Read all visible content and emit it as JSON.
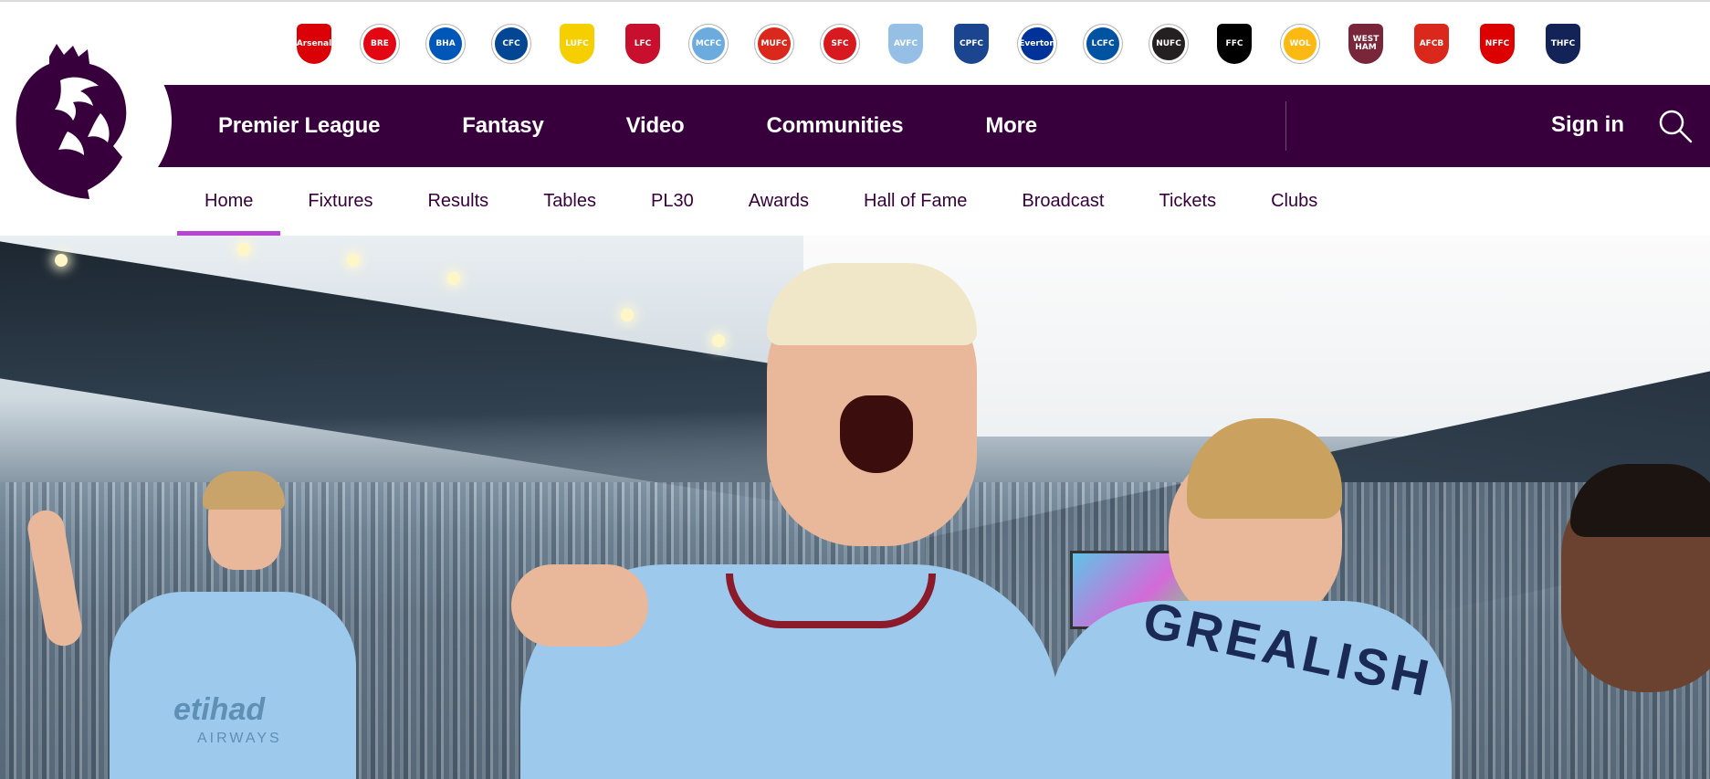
{
  "clubs": [
    {
      "name": "Arsenal",
      "abbr": "Arsenal",
      "color": "#db0007",
      "shape": "shield"
    },
    {
      "name": "Brentford",
      "abbr": "BRE",
      "color": "#e30613",
      "shape": "round"
    },
    {
      "name": "Brighton",
      "abbr": "BHA",
      "color": "#0057b8",
      "shape": "round"
    },
    {
      "name": "Chelsea",
      "abbr": "CFC",
      "color": "#034694",
      "shape": "round"
    },
    {
      "name": "Leeds United",
      "abbr": "LUFC",
      "color": "#f5cf00",
      "shape": "shield"
    },
    {
      "name": "Liverpool",
      "abbr": "LFC",
      "color": "#c8102e",
      "shape": "shield"
    },
    {
      "name": "Manchester City",
      "abbr": "MCFC",
      "color": "#6cabdd",
      "shape": "round"
    },
    {
      "name": "Manchester United",
      "abbr": "MUFC",
      "color": "#da291c",
      "shape": "round"
    },
    {
      "name": "Southampton",
      "abbr": "SFC",
      "color": "#d71920",
      "shape": "round"
    },
    {
      "name": "Aston Villa",
      "abbr": "AVFC",
      "color": "#95bfe5",
      "shape": "shield"
    },
    {
      "name": "Crystal Palace",
      "abbr": "CPFC",
      "color": "#1b458f",
      "shape": "shield"
    },
    {
      "name": "Everton",
      "abbr": "Everton",
      "color": "#003399",
      "shape": "round"
    },
    {
      "name": "Leicester City",
      "abbr": "LCFC",
      "color": "#0053a0",
      "shape": "round"
    },
    {
      "name": "Newcastle United",
      "abbr": "NUFC",
      "color": "#241f20",
      "shape": "round"
    },
    {
      "name": "Fulham",
      "abbr": "FFC",
      "color": "#000000",
      "shape": "shield"
    },
    {
      "name": "Wolves",
      "abbr": "WOL",
      "color": "#fdb913",
      "shape": "round"
    },
    {
      "name": "West Ham",
      "abbr": "WEST HAM",
      "color": "#7a263a",
      "shape": "shield"
    },
    {
      "name": "Bournemouth",
      "abbr": "AFCB",
      "color": "#da291c",
      "shape": "shield"
    },
    {
      "name": "Nottingham Forest",
      "abbr": "NFFC",
      "color": "#dd0000",
      "shape": "shield"
    },
    {
      "name": "Tottenham",
      "abbr": "THFC",
      "color": "#132257",
      "shape": "shield"
    }
  ],
  "primary_nav": {
    "premier_league": "Premier League",
    "fantasy": "Fantasy",
    "video": "Video",
    "communities": "Communities",
    "more": "More",
    "sign_in": "Sign in"
  },
  "secondary_nav": [
    "Home",
    "Fixtures",
    "Results",
    "Tables",
    "PL30",
    "Awards",
    "Hall of Fame",
    "Broadcast",
    "Tickets",
    "Clubs"
  ],
  "colors": {
    "brand_purple": "#37003c",
    "active_underline": "#b844d4"
  },
  "hero": {
    "shirt_text_left": "etihad",
    "shirt_text_left2": "AIRWAYS",
    "shirt_text_right": "GREALISH"
  }
}
